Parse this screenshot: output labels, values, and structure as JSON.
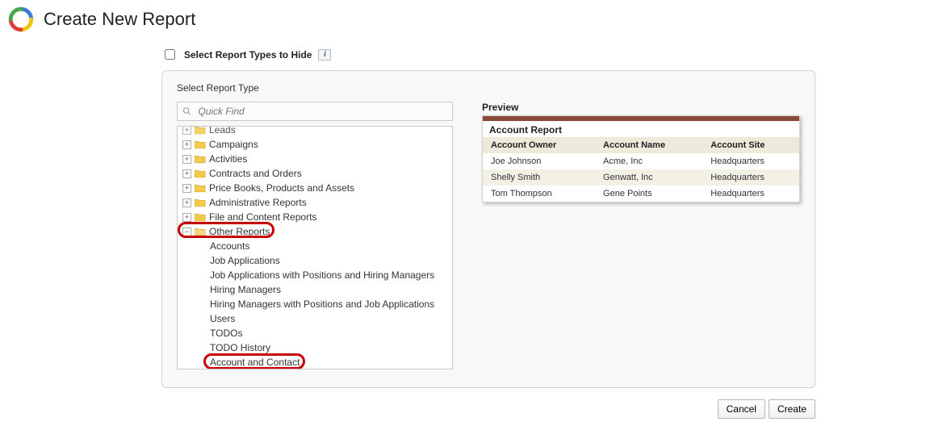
{
  "header": {
    "title": "Create New Report"
  },
  "hideCheckbox": {
    "label": "Select Report Types to Hide"
  },
  "panel": {
    "title": "Select Report Type"
  },
  "search": {
    "placeholder": "Quick Find"
  },
  "tree": {
    "folders": [
      {
        "label": "Leads",
        "state": "collapsed",
        "topcut": true
      },
      {
        "label": "Campaigns",
        "state": "collapsed"
      },
      {
        "label": "Activities",
        "state": "collapsed"
      },
      {
        "label": "Contracts and Orders",
        "state": "collapsed"
      },
      {
        "label": "Price Books, Products and Assets",
        "state": "collapsed"
      },
      {
        "label": "Administrative Reports",
        "state": "collapsed"
      },
      {
        "label": "File and Content Reports",
        "state": "collapsed"
      },
      {
        "label": "Other Reports",
        "state": "expanded",
        "highlighted": true
      }
    ],
    "leaves": [
      "Accounts",
      "Job Applications",
      "Job Applications with Positions and Hiring Managers",
      "Hiring Managers",
      "Hiring Managers with Positions and Job Applications",
      "Users",
      "TODOs",
      "TODO History",
      "Account and Contact"
    ],
    "highlightedLeaf": "Account and Contact"
  },
  "preview": {
    "heading": "Preview",
    "report_title": "Account Report",
    "columns": [
      "Account  Owner",
      "Account Name",
      "Account Site"
    ],
    "rows": [
      [
        "Joe Johnson",
        "Acme, Inc",
        "Headquarters"
      ],
      [
        "Shelly Smith",
        "Genwatt, Inc",
        "Headquarters"
      ],
      [
        "Tom Thompson",
        "Gene Points",
        "Headquarters"
      ]
    ]
  },
  "buttons": {
    "cancel": "Cancel",
    "create": "Create"
  }
}
